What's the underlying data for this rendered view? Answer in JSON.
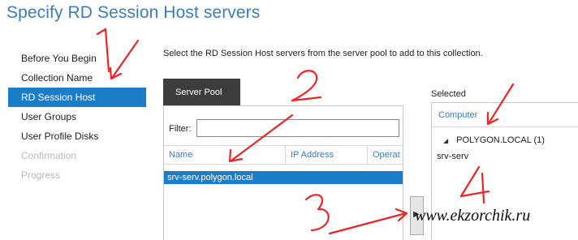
{
  "page": {
    "title": "Specify RD Session Host servers"
  },
  "nav": {
    "items": [
      {
        "label": "Before You Begin",
        "state": "normal"
      },
      {
        "label": "Collection Name",
        "state": "normal"
      },
      {
        "label": "RD Session Host",
        "state": "active"
      },
      {
        "label": "User Groups",
        "state": "normal"
      },
      {
        "label": "User Profile Disks",
        "state": "normal"
      },
      {
        "label": "Confirmation",
        "state": "disabled"
      },
      {
        "label": "Progress",
        "state": "disabled"
      }
    ]
  },
  "main": {
    "instructions": "Select the RD Session Host servers from the server pool to add to this collection."
  },
  "server_pool": {
    "tab_label": "Server Pool",
    "filter_label": "Filter:",
    "filter_value": "",
    "columns": [
      "Name",
      "IP Address",
      "Operat"
    ],
    "rows": [
      {
        "name": "srv-serv.polygon.local",
        "ip": "",
        "os": ""
      }
    ]
  },
  "move_button": {
    "icon": "triangle-right-icon",
    "glyph": "▶"
  },
  "selected": {
    "label": "Selected",
    "column": "Computer",
    "group": "POLYGON.LOCAL (1)",
    "group_glyph": "◢",
    "items": [
      "srv-serv"
    ]
  },
  "annotations": {
    "numbers": [
      "1",
      "2",
      "3",
      "4"
    ],
    "watermark": "www.ekzorchik.ru",
    "color": "#e8262a"
  },
  "colors": {
    "accent": "#1b7cc8",
    "title": "#3c7db8",
    "tab": "#3c3c3c"
  }
}
